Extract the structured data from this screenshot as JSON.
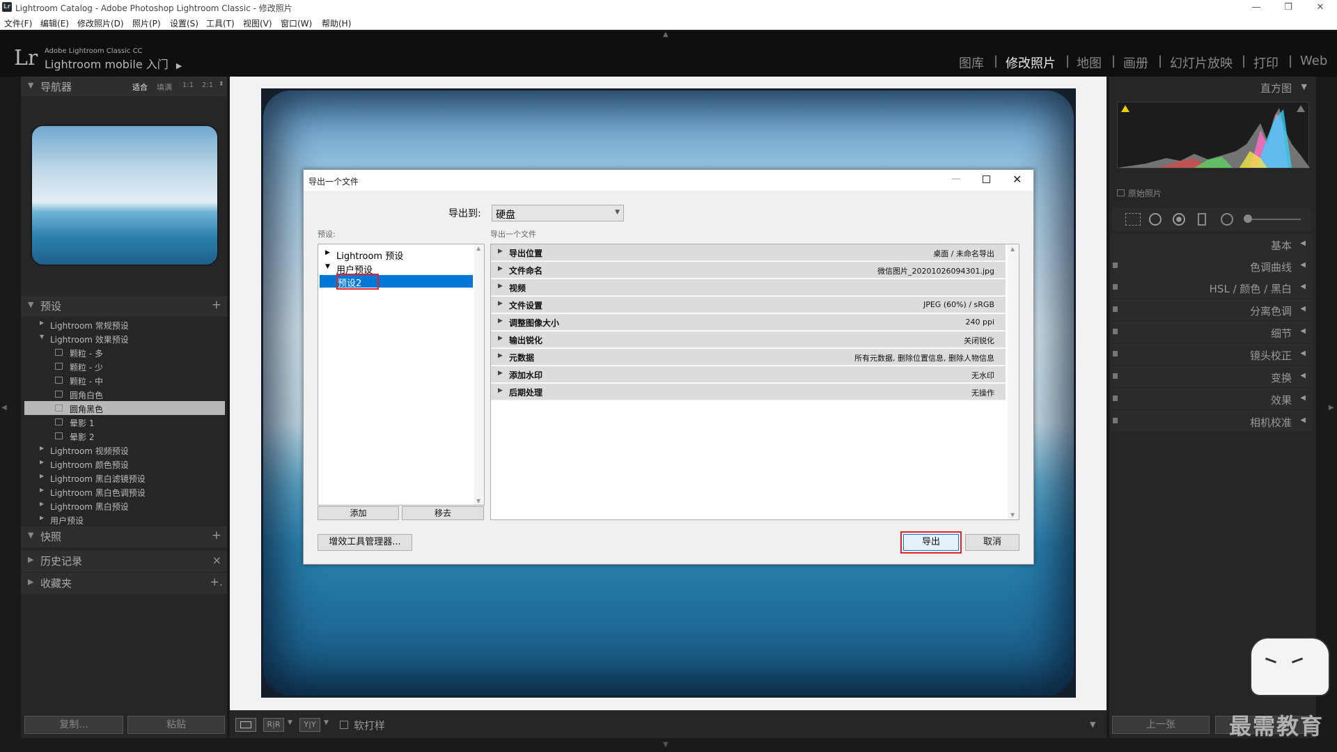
{
  "window": {
    "title": "Lightroom Catalog - Adobe Photoshop Lightroom Classic - 修改照片",
    "logo": "Lr",
    "controls": {
      "minimize": "—",
      "restore": "❐",
      "close": "✕"
    }
  },
  "menu": [
    "文件(F)",
    "编辑(E)",
    "修改照片(D)",
    "照片(P)",
    "设置(S)",
    "工具(T)",
    "视图(V)",
    "窗口(W)",
    "帮助(H)"
  ],
  "brand": {
    "logo": "Lr",
    "product": "Adobe Lightroom Classic CC",
    "mobile": "Lightroom mobile 入门",
    "arrow": "▶"
  },
  "modules": [
    "图库",
    "修改照片",
    "地图",
    "画册",
    "幻灯片放映",
    "打印",
    "Web"
  ],
  "module_separator": "|",
  "navigator": {
    "title": "导航器",
    "zoom": [
      "适合",
      "填满",
      "1:1",
      "2:1"
    ]
  },
  "presets": {
    "title": "预设",
    "add": "+",
    "items": [
      {
        "label": "Lightroom 常规预设",
        "level": 0,
        "expanded": false
      },
      {
        "label": "Lightroom 效果预设",
        "level": 0,
        "expanded": true
      },
      {
        "label": "颗粒 - 多",
        "level": 1
      },
      {
        "label": "颗粒 - 少",
        "level": 1
      },
      {
        "label": "颗粒 - 中",
        "level": 1
      },
      {
        "label": "圆角白色",
        "level": 1
      },
      {
        "label": "圆角黑色",
        "level": 1,
        "selected": true
      },
      {
        "label": "晕影 1",
        "level": 1
      },
      {
        "label": "晕影 2",
        "level": 1
      },
      {
        "label": "Lightroom 视频预设",
        "level": 0
      },
      {
        "label": "Lightroom 颜色预设",
        "level": 0
      },
      {
        "label": "Lightroom 黑白滤镜预设",
        "level": 0
      },
      {
        "label": "Lightroom 黑白色调预设",
        "level": 0
      },
      {
        "label": "Lightroom 黑白预设",
        "level": 0
      },
      {
        "label": "用户预设",
        "level": 0
      }
    ]
  },
  "left_sections": [
    {
      "title": "快照",
      "action": "+"
    },
    {
      "title": "历史记录",
      "action": "×"
    },
    {
      "title": "收藏夹",
      "action": "+."
    }
  ],
  "left_bottom": {
    "copy": "复制...",
    "paste": "粘贴"
  },
  "right_panel": {
    "histogram_title": "直方图",
    "original_photo": "原始照片",
    "sections": [
      "基本",
      "色调曲线",
      "HSL / 颜色 / 黑白",
      "分离色调",
      "细节",
      "镜头校正",
      "变换",
      "效果",
      "相机校准"
    ]
  },
  "right_bottom": {
    "previous": "上一张"
  },
  "toolbar": {
    "soft_proof": "软打样",
    "view_ry": "R|R",
    "view_yy": "Y|Y"
  },
  "watermark": "最需教育",
  "dialog": {
    "title": "导出一个文件",
    "export_to_label": "导出到:",
    "export_to_value": "硬盘",
    "presets_label": "预设:",
    "settings_label": "导出一个文件",
    "tree": [
      {
        "label": "Lightroom 预设",
        "expanded": false
      },
      {
        "label": "用户预设",
        "expanded": true
      },
      {
        "label": "预设2",
        "selected": true
      }
    ],
    "add": "添加",
    "remove": "移去",
    "rows": [
      {
        "label": "导出位置",
        "value": "桌面 / 未命名导出"
      },
      {
        "label": "文件命名",
        "value": "微信图片_20201026094301.jpg"
      },
      {
        "label": "视频",
        "value": ""
      },
      {
        "label": "文件设置",
        "value": "JPEG (60%) / sRGB"
      },
      {
        "label": "调整图像大小",
        "value": "240 ppi"
      },
      {
        "label": "输出锐化",
        "value": "关闭锐化"
      },
      {
        "label": "元数据",
        "value": "所有元数据, 删除位置信息, 删除人物信息"
      },
      {
        "label": "添加水印",
        "value": "无水印"
      },
      {
        "label": "后期处理",
        "value": "无操作"
      }
    ],
    "plugin_manager": "增效工具管理器...",
    "export": "导出",
    "cancel": "取消"
  },
  "colors": {
    "selection": "#0078d7",
    "highlight": "#e0242a",
    "panel": "#262626"
  }
}
